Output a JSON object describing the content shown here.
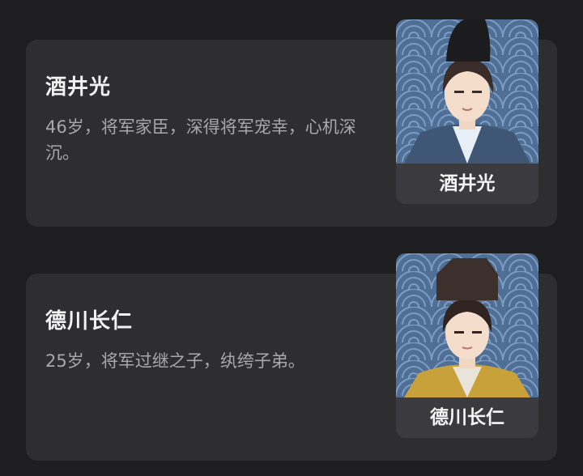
{
  "characters": [
    {
      "name": "酒井光",
      "description": "46岁，将军家臣，深得将军宠幸，心机深沉。",
      "portrait_caption": "酒井光",
      "robe_color": "#3f5775",
      "collar_color": "#e8eef5"
    },
    {
      "name": "德川长仁",
      "description": "25岁，将军过继之子，纨绔子弟。",
      "portrait_caption": "德川长仁",
      "robe_color": "#c9a13a",
      "collar_color": "#e9e4da"
    }
  ],
  "colors": {
    "background": "#1e1e20",
    "card": "#2e2e31",
    "portrait_bg": "#4f6f97",
    "wave_line": "#7d9cc2"
  }
}
